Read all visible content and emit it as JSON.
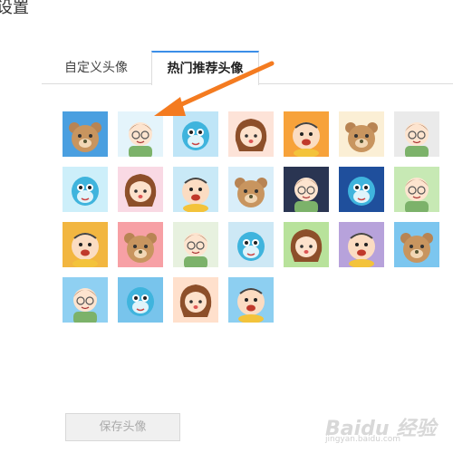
{
  "header": {
    "title": "设置"
  },
  "tabs": [
    {
      "label": "自定义头像",
      "active": false
    },
    {
      "label": "热门推荐头像",
      "active": true
    }
  ],
  "avatars": [
    {
      "name": "bear-blue",
      "bg": "#4a9fe0",
      "kind": "bear"
    },
    {
      "name": "boy-green-wave",
      "bg": "#e4f4fb",
      "kind": "boy"
    },
    {
      "name": "blue-dolphin",
      "bg": "#bfe5f7",
      "kind": "dolphin"
    },
    {
      "name": "girl-brown-hair",
      "bg": "#fde3d8",
      "kind": "girl"
    },
    {
      "name": "bald-man-red-mouth",
      "bg": "#f7a23a",
      "kind": "baldman"
    },
    {
      "name": "bear-cream",
      "bg": "#fbefd5",
      "kind": "bear"
    },
    {
      "name": "boy-glasses-green",
      "bg": "#eaeaea",
      "kind": "boy"
    },
    {
      "name": "blue-dolphin-wide",
      "bg": "#cdeffa",
      "kind": "dolphin"
    },
    {
      "name": "girl-pink-bg",
      "bg": "#f9d9e4",
      "kind": "girl"
    },
    {
      "name": "bald-man-light-blue",
      "bg": "#c9e9f7",
      "kind": "baldman"
    },
    {
      "name": "bear-sitting",
      "bg": "#d9eef9",
      "kind": "bear"
    },
    {
      "name": "boy-night",
      "bg": "#2a3552",
      "kind": "boy"
    },
    {
      "name": "rabbit-dolphin-blue",
      "bg": "#1f4f9c",
      "kind": "dolphin"
    },
    {
      "name": "sunglasses-boy",
      "bg": "#c7e9b4",
      "kind": "boy"
    },
    {
      "name": "bald-duck",
      "bg": "#f2b640",
      "kind": "baldman"
    },
    {
      "name": "bear-pink-bg",
      "bg": "#f7a0a5",
      "kind": "bear"
    },
    {
      "name": "boy-hands-up",
      "bg": "#e7f1df",
      "kind": "boy"
    },
    {
      "name": "blue-dolphin-play",
      "bg": "#cde8f5",
      "kind": "dolphin"
    },
    {
      "name": "girl-green-bg",
      "bg": "#b8e29b",
      "kind": "girl"
    },
    {
      "name": "bald-purple",
      "bg": "#b7a2db",
      "kind": "baldman"
    },
    {
      "name": "bear-sky",
      "bg": "#7cc6ef",
      "kind": "bear"
    },
    {
      "name": "boy-beach",
      "bg": "#8fd0f2",
      "kind": "boy"
    },
    {
      "name": "dolphin-beach",
      "bg": "#78c4ec",
      "kind": "dolphin"
    },
    {
      "name": "girl-beach",
      "bg": "#ffe0cc",
      "kind": "girl"
    },
    {
      "name": "bald-beach",
      "bg": "#8dcff1",
      "kind": "baldman"
    }
  ],
  "actions": {
    "save_label": "保存头像"
  },
  "watermark": {
    "text": "Baidu 经验",
    "sub": "jingyan.baidu.com"
  },
  "colors": {
    "accent": "#3b8ee8",
    "arrow": "#f47b20"
  }
}
